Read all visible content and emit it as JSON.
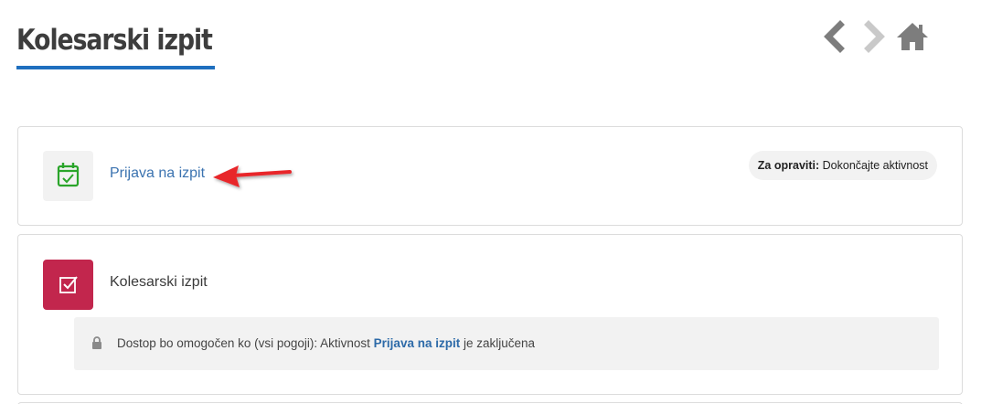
{
  "page": {
    "title": "Kolesarski izpit"
  },
  "nav": {
    "back_icon": "chevron-left-icon",
    "forward_icon": "chevron-right-icon",
    "home_icon": "home-icon"
  },
  "activities": [
    {
      "icon": "calendar-check-icon",
      "name": "Prijava na izpit",
      "completion": {
        "label": "Za opraviti:",
        "value": "Dokončajte aktivnost"
      }
    },
    {
      "icon": "checkbox-icon",
      "name": "Kolesarski izpit",
      "restriction": {
        "prefix": "Dostop bo omogočen ko (vsi pogoji): Aktivnost",
        "link": "Prijava na izpit",
        "suffix": "je zaključena"
      }
    }
  ],
  "colors": {
    "accent": "#1f6fbf",
    "link": "#3b73b0",
    "quiz_icon_bg": "#c2264d",
    "calendar_icon": "#2aa52a",
    "annotation_arrow": "#e8262c"
  }
}
